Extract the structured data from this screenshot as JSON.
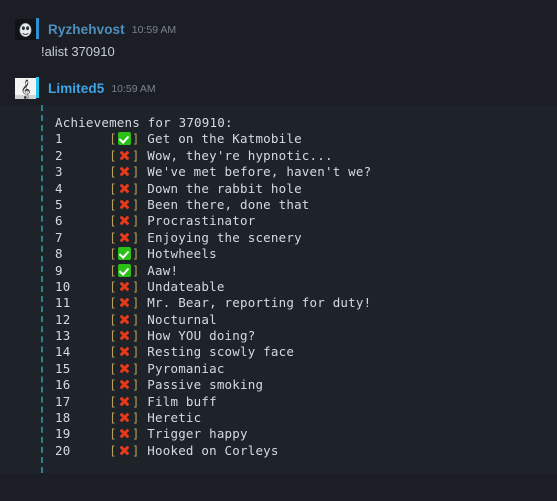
{
  "app": {
    "background_color": "#1b1e24",
    "codeblock_background": "#1e2229",
    "quote_bar_color": "#2f7f8c"
  },
  "messages": [
    {
      "avatar_icon": "egg-avatar-icon",
      "username": "Ryzhehvost",
      "username_color": "#4f8fbe",
      "timestamp": "10:59 AM",
      "accent_bar_color": "#2f8fd4",
      "text": "!alist 370910"
    },
    {
      "avatar_icon": "bass-clef-avatar-icon",
      "username": "Limited5",
      "username_color": "#3ea6e6",
      "timestamp": "10:59 AM",
      "accent_bar_color": "#26c6f0",
      "text": ""
    }
  ],
  "codeblock": {
    "title": "Achievemens for 370910:",
    "bracket_open": "[",
    "bracket_close": "]",
    "check_color": "#2bc016",
    "cross_color": "#e63a1a",
    "rows": [
      {
        "index": "1",
        "status": "check",
        "label": "Get on the Katmobile"
      },
      {
        "index": "2",
        "status": "cross",
        "label": "Wow, they're hypnotic..."
      },
      {
        "index": "3",
        "status": "cross",
        "label": "We've met before, haven't we?"
      },
      {
        "index": "4",
        "status": "cross",
        "label": "Down the rabbit hole"
      },
      {
        "index": "5",
        "status": "cross",
        "label": "Been there, done that"
      },
      {
        "index": "6",
        "status": "cross",
        "label": "Procrastinator"
      },
      {
        "index": "7",
        "status": "cross",
        "label": "Enjoying the scenery"
      },
      {
        "index": "8",
        "status": "check",
        "label": "Hotwheels"
      },
      {
        "index": "9",
        "status": "check",
        "label": "Aaw!"
      },
      {
        "index": "10",
        "status": "cross",
        "label": "Undateable"
      },
      {
        "index": "11",
        "status": "cross",
        "label": "Mr. Bear, reporting for duty!"
      },
      {
        "index": "12",
        "status": "cross",
        "label": "Nocturnal"
      },
      {
        "index": "13",
        "status": "cross",
        "label": "How YOU doing?"
      },
      {
        "index": "14",
        "status": "cross",
        "label": "Resting scowly face"
      },
      {
        "index": "15",
        "status": "cross",
        "label": "Pyromaniac"
      },
      {
        "index": "16",
        "status": "cross",
        "label": "Passive smoking"
      },
      {
        "index": "17",
        "status": "cross",
        "label": "Film buff"
      },
      {
        "index": "18",
        "status": "cross",
        "label": "Heretic"
      },
      {
        "index": "19",
        "status": "cross",
        "label": "Trigger happy"
      },
      {
        "index": "20",
        "status": "cross",
        "label": "Hooked on Corleys"
      }
    ]
  }
}
